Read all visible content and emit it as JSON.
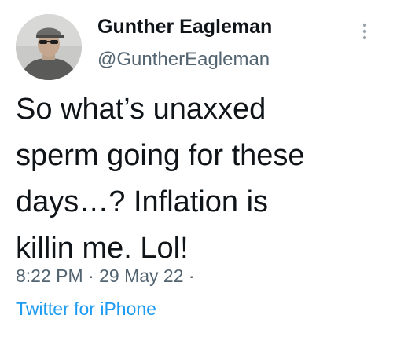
{
  "author": {
    "display_name": "Gunther Eagleman",
    "handle": "@GuntherEagleman"
  },
  "tweet": {
    "text_lines": [
      "So what’s unaxxed",
      "sperm going for these",
      "days…?  Inflation is",
      "killin me.  Lol!"
    ],
    "meta": "8:22 PM · 29 May 22 ·",
    "source": "Twitter for iPhone"
  },
  "icons": {
    "more": "more-vertical-icon",
    "avatar": "profile-photo"
  },
  "colors": {
    "text": "#0f1419",
    "secondary": "#536471",
    "link": "#1d9bf0",
    "background": "#ffffff"
  }
}
